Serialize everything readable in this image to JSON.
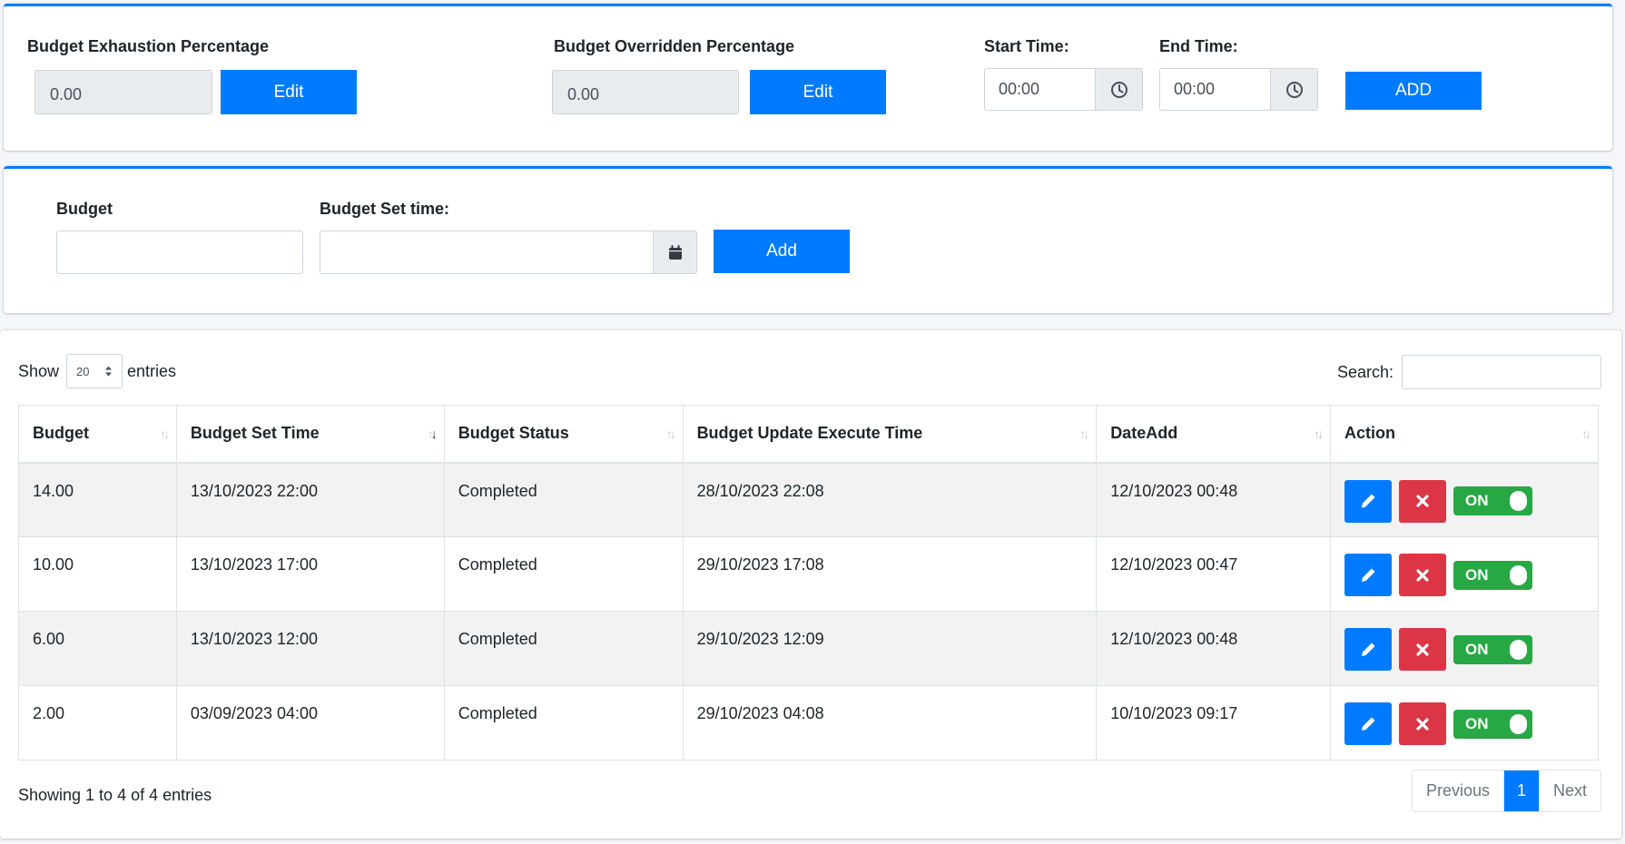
{
  "settings": {
    "exhaustion": {
      "label": "Budget Exhaustion Percentage",
      "value": "0.00",
      "edit_label": "Edit"
    },
    "overridden": {
      "label": "Budget Overridden Percentage",
      "value": "0.00",
      "edit_label": "Edit"
    },
    "start_time": {
      "label": "Start Time:",
      "value": "00:00"
    },
    "end_time": {
      "label": "End Time:",
      "value": "00:00"
    },
    "add_label": "ADD"
  },
  "budget_form": {
    "budget_label": "Budget",
    "budget_value": "",
    "set_time_label": "Budget Set time:",
    "set_time_value": "",
    "add_label": "Add"
  },
  "table": {
    "show_label": "Show",
    "page_size": "20",
    "entries_label": "entries",
    "search_label": "Search:",
    "search_value": "",
    "columns": [
      "Budget",
      "Budget Set Time",
      "Budget Status",
      "Budget Update Execute Time",
      "DateAdd",
      "Action"
    ],
    "rows": [
      {
        "budget": "14.00",
        "set_time": "13/10/2023 22:00",
        "status": "Completed",
        "execute_time": "28/10/2023 22:08",
        "date_add": "12/10/2023 00:48",
        "toggle": "ON"
      },
      {
        "budget": "10.00",
        "set_time": "13/10/2023 17:00",
        "status": "Completed",
        "execute_time": "29/10/2023 17:08",
        "date_add": "12/10/2023 00:47",
        "toggle": "ON"
      },
      {
        "budget": "6.00",
        "set_time": "13/10/2023 12:00",
        "status": "Completed",
        "execute_time": "29/10/2023 12:09",
        "date_add": "12/10/2023 00:48",
        "toggle": "ON"
      },
      {
        "budget": "2.00",
        "set_time": "03/09/2023 04:00",
        "status": "Completed",
        "execute_time": "29/10/2023 04:08",
        "date_add": "10/10/2023 09:17",
        "toggle": "ON"
      }
    ],
    "info": "Showing 1 to 4 of 4 entries",
    "pagination": {
      "previous": "Previous",
      "current": "1",
      "next": "Next"
    }
  },
  "icons": {
    "time": "clock-icon",
    "date": "calendar-icon",
    "edit": "pencil-icon",
    "delete": "times-icon",
    "sort": "sort-arrows-icon"
  },
  "colors": {
    "primary": "#007bff",
    "danger": "#dc3545",
    "success": "#28a745"
  }
}
